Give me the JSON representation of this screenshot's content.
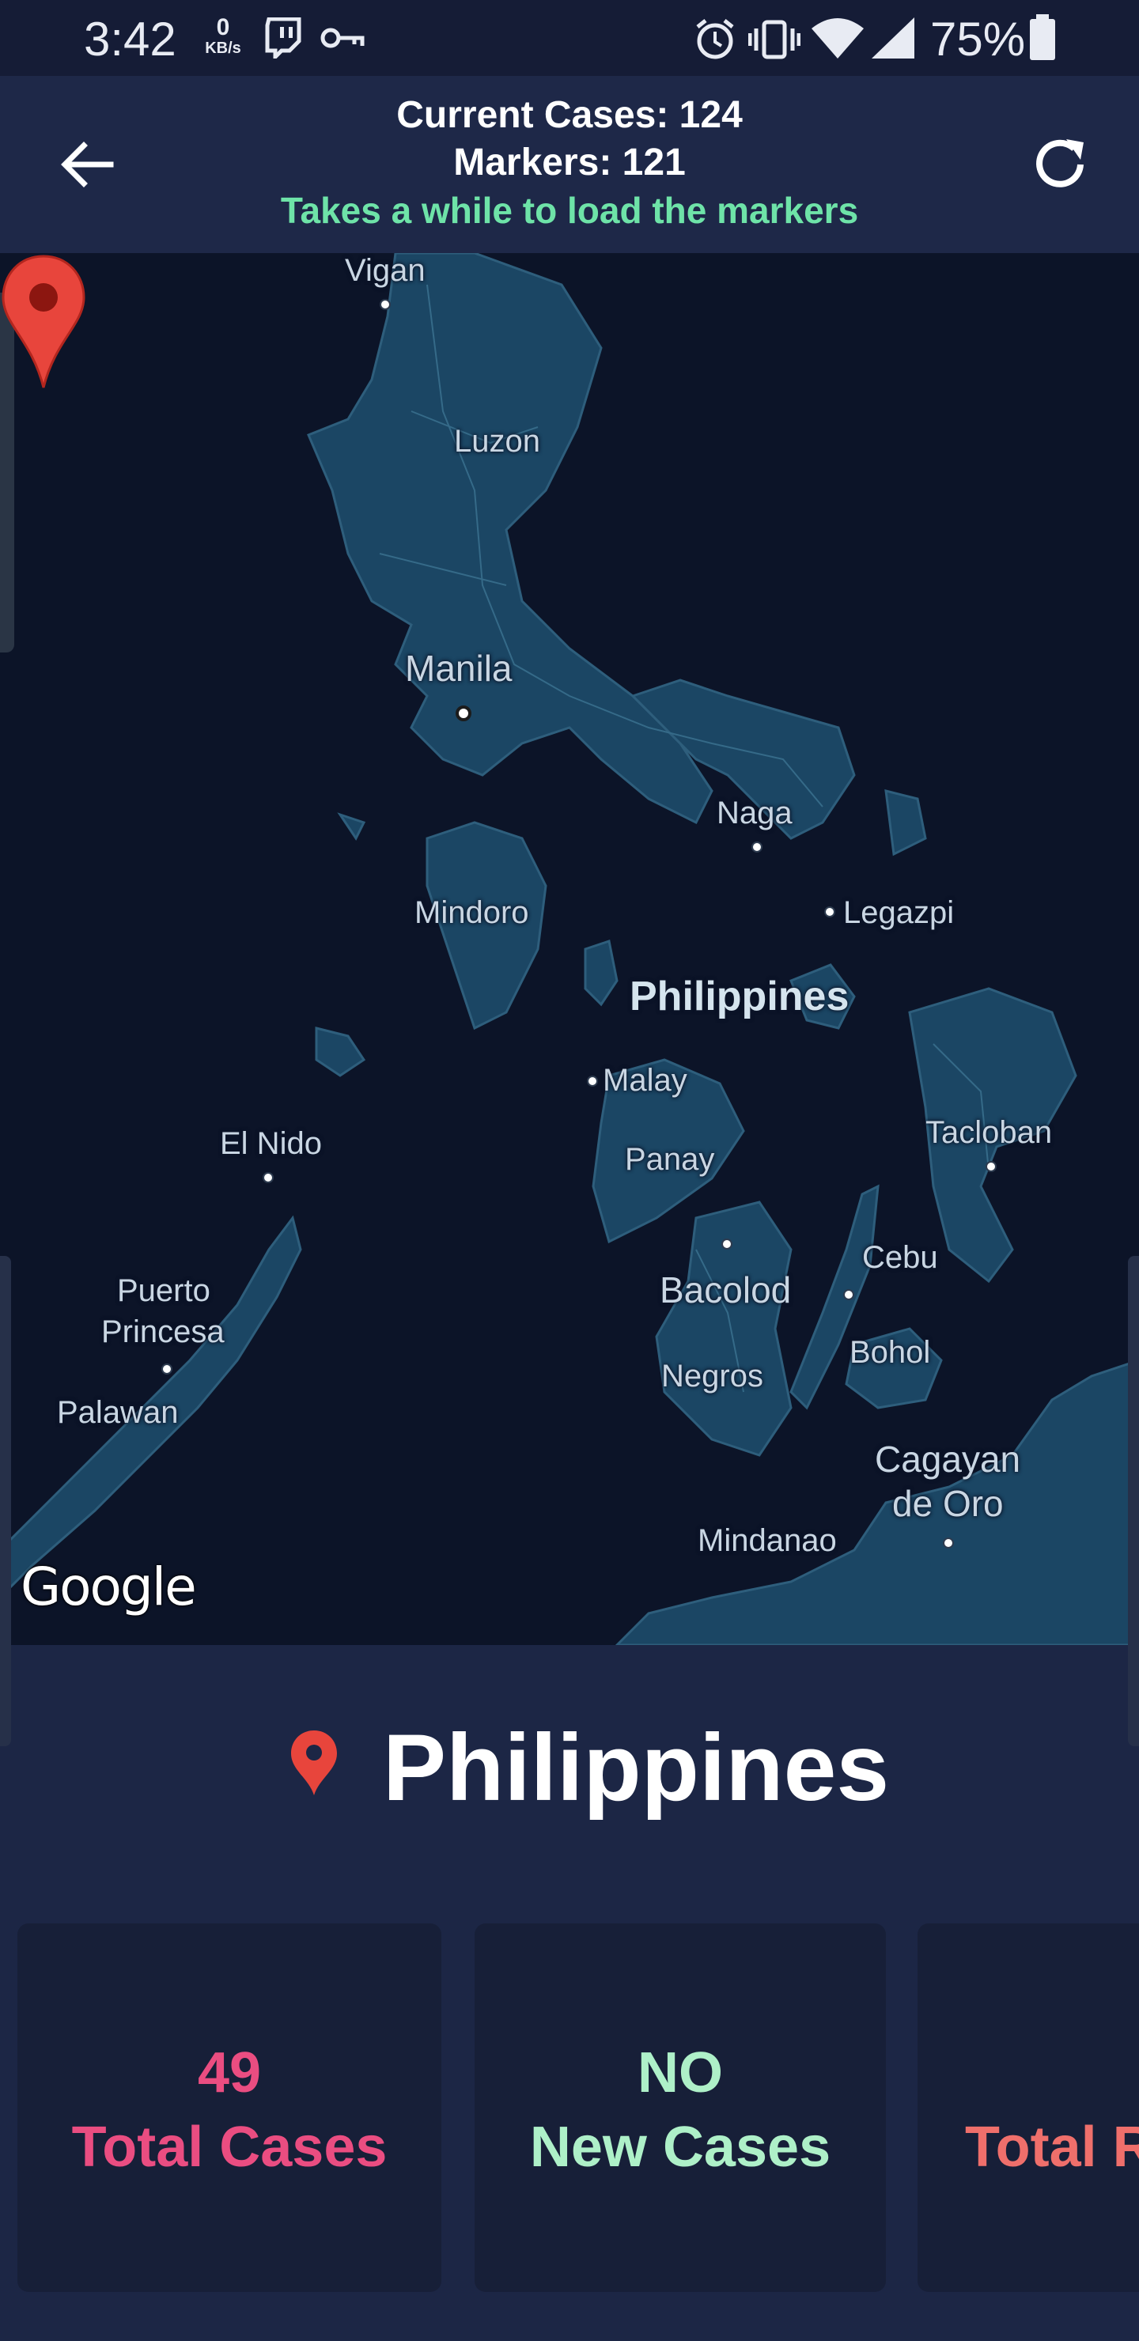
{
  "status_bar": {
    "time": "3:42",
    "net_speed_value": "0",
    "net_speed_unit": "KB/s",
    "battery": "75%",
    "icons": [
      "twitch-icon",
      "key-icon",
      "alarm-icon",
      "vibrate-icon",
      "wifi-icon",
      "signal-icon",
      "battery-icon"
    ]
  },
  "header": {
    "current_cases": "Current Cases: 124",
    "markers": "Markers: 121",
    "note": "Takes a while to load the markers",
    "back_icon": "arrow-left-icon",
    "refresh_icon": "refresh-icon"
  },
  "map": {
    "labels": {
      "vigan": "Vigan",
      "luzon": "Luzon",
      "manila": "Manila",
      "naga": "Naga",
      "legazpi": "Legazpi",
      "mindoro": "Mindoro",
      "philippines": "Philippines",
      "malay": "Malay",
      "el_nido": "El Nido",
      "panay": "Panay",
      "tacloban": "Tacloban",
      "cebu": "Cebu",
      "bacolod": "Bacolod",
      "puerto": "Puerto",
      "princesa": "Princesa",
      "bohol": "Bohol",
      "negros": "Negros",
      "palawan": "Palawan",
      "cagayan": "Cagayan",
      "de_oro": "de Oro",
      "mindanao": "Mindanao"
    },
    "attribution": "Google",
    "colors": {
      "water": "#0c1428",
      "land": "#1b4664",
      "road": "#2e5e7c"
    }
  },
  "location": {
    "country": "Philippines",
    "pin_color": "#e8453c"
  },
  "stats": [
    {
      "value": "49",
      "label": "Total Cases",
      "color": "#ea4d81"
    },
    {
      "value": "NO",
      "label": "New Cases",
      "color": "#aef0c8"
    },
    {
      "value": "",
      "label": "Total R",
      "color": "#ef6f6b"
    }
  ]
}
